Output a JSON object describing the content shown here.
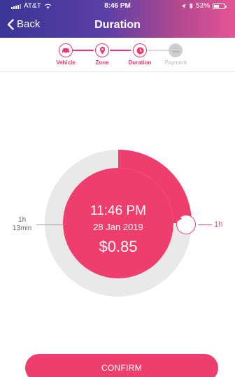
{
  "status_bar": {
    "carrier": "AT&T",
    "time": "8:46 PM",
    "battery": "53%",
    "battery_level": 0.53
  },
  "nav": {
    "back_label": "Back",
    "title": "Duration"
  },
  "stepper": {
    "steps": [
      {
        "label": "Vehicle",
        "icon": "car-icon",
        "state": "done"
      },
      {
        "label": "Zone",
        "icon": "location-pin-icon",
        "state": "done"
      },
      {
        "label": "Duration",
        "icon": "clock-icon",
        "state": "current"
      },
      {
        "label": "Payment",
        "icon": "card-icon",
        "state": "inactive"
      }
    ]
  },
  "dial": {
    "end_time": "11:46 PM",
    "end_date": "28 Jan 2019",
    "price": "$0.85",
    "selected_duration_hours": 3,
    "left_label_line1": "1h",
    "left_label_line2": "13min",
    "handle_label": "1h"
  },
  "colors": {
    "accent": "#ef3e6e",
    "track": "#e9e9e9",
    "inactive": "#cfcfcf"
  },
  "confirm": {
    "label": "CONFIRM"
  }
}
